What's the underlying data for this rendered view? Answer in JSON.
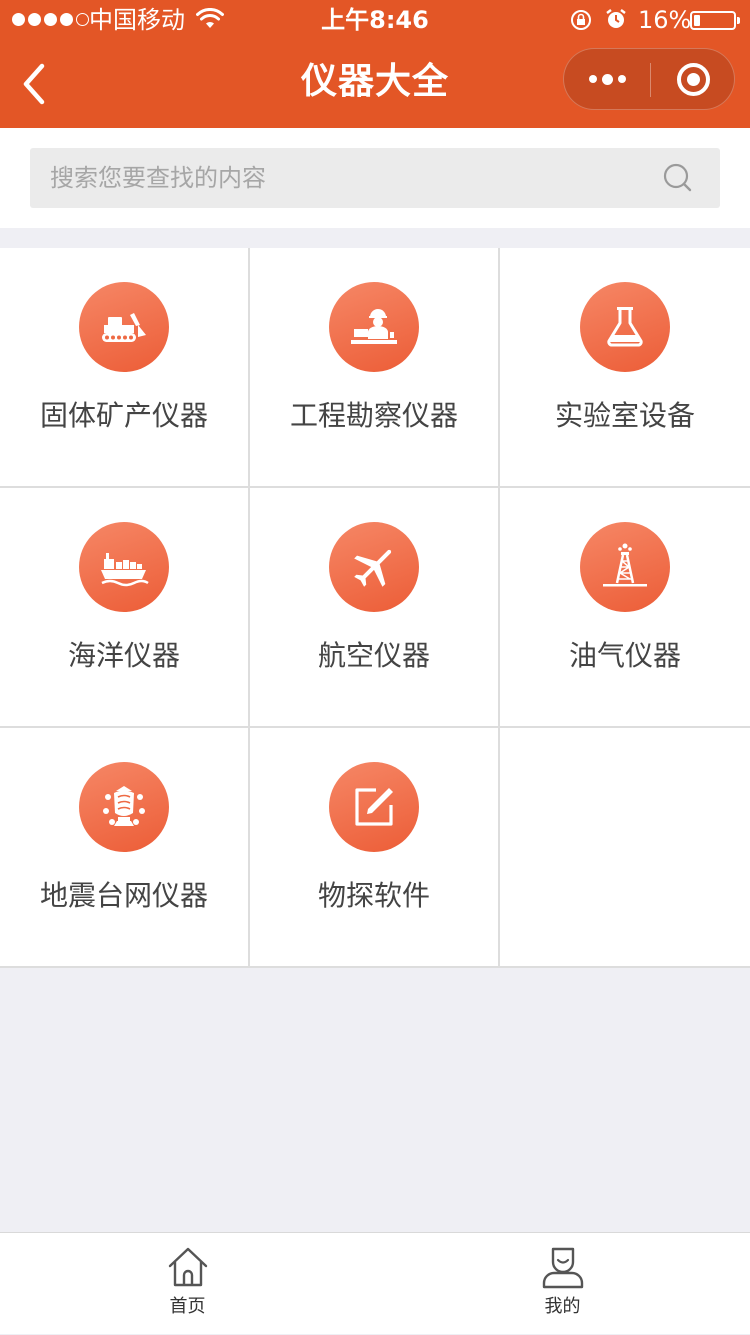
{
  "status_bar": {
    "carrier": "中国移动",
    "time": "上午8:46",
    "battery_percent_label": "16%",
    "battery_level": 0.16,
    "signal_bars_filled": 4,
    "signal_bars_total": 5
  },
  "nav": {
    "title": "仪器大全"
  },
  "search": {
    "placeholder": "搜索您要查找的内容",
    "value": ""
  },
  "colors": {
    "brand": "#e35626",
    "icon_circle_top": "#f68766",
    "icon_circle_bottom": "#ec5d37"
  },
  "categories": [
    {
      "label": "固体矿产仪器",
      "icon": "bulldozer-icon"
    },
    {
      "label": "工程勘察仪器",
      "icon": "engineer-icon"
    },
    {
      "label": "实验室设备",
      "icon": "flask-icon"
    },
    {
      "label": "海洋仪器",
      "icon": "ship-icon"
    },
    {
      "label": "航空仪器",
      "icon": "airplane-icon"
    },
    {
      "label": "油气仪器",
      "icon": "oil-derrick-icon"
    },
    {
      "label": "地震台网仪器",
      "icon": "seismograph-icon"
    },
    {
      "label": "物探软件",
      "icon": "edit-icon"
    }
  ],
  "tabbar": {
    "items": [
      {
        "label": "首页",
        "icon": "home-icon"
      },
      {
        "label": "我的",
        "icon": "user-icon"
      }
    ]
  }
}
